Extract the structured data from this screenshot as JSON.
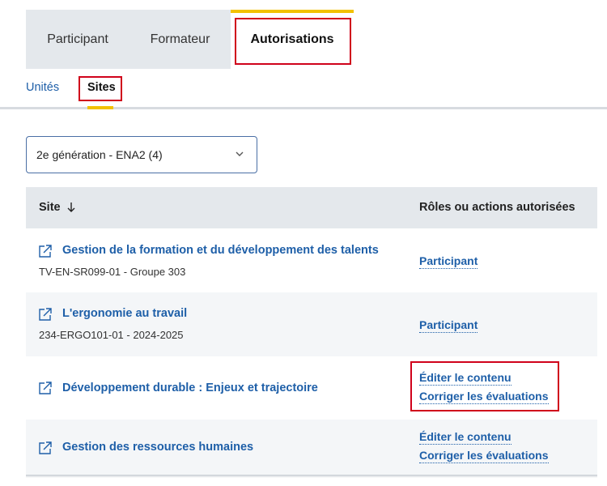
{
  "tabs": {
    "participant": "Participant",
    "formateur": "Formateur",
    "autorisations": "Autorisations"
  },
  "subtabs": {
    "unites": "Unités",
    "sites": "Sites"
  },
  "filter": {
    "selected": "2e génération - ENA2 (4)"
  },
  "table": {
    "headers": {
      "site": "Site",
      "roles": "Rôles ou actions autorisées"
    },
    "rows": [
      {
        "title": "Gestion de la formation et du développement des talents",
        "subtitle": "TV-EN-SR099-01 - Groupe 303",
        "roles": [
          "Participant"
        ]
      },
      {
        "title": "L'ergonomie au travail",
        "subtitle": "234-ERGO101-01 - 2024-2025",
        "roles": [
          "Participant"
        ]
      },
      {
        "title": "Développement durable : Enjeux et trajectoire",
        "subtitle": "",
        "roles": [
          "Éditer le contenu",
          "Corriger les évaluations"
        ]
      },
      {
        "title": "Gestion des ressources humaines",
        "subtitle": "",
        "roles": [
          "Éditer le contenu",
          "Corriger les évaluations"
        ]
      }
    ]
  },
  "colors": {
    "accent": "#f2c100",
    "link": "#1e5fa8",
    "highlight": "#d0021b",
    "tab_bg": "#e4e8ec"
  }
}
